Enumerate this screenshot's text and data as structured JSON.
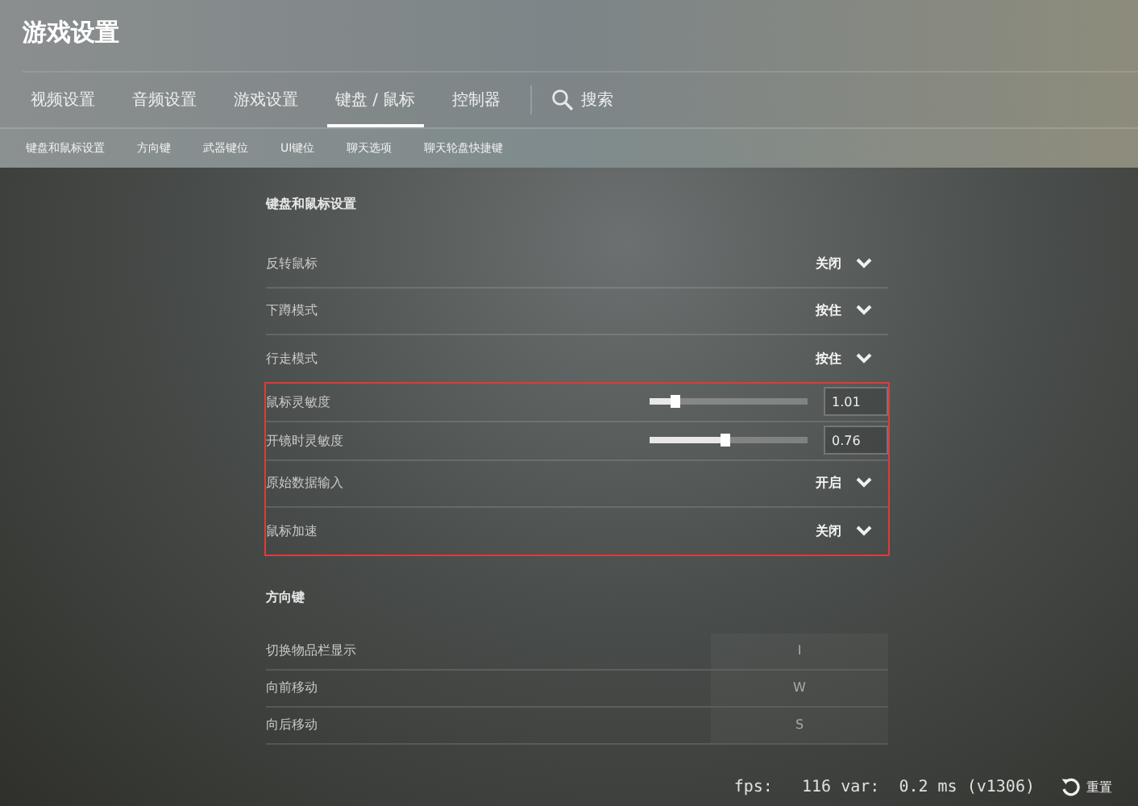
{
  "window": {
    "title": "游戏设置"
  },
  "tabs": [
    {
      "label": "视频设置",
      "selected": false
    },
    {
      "label": "音频设置",
      "selected": false
    },
    {
      "label": "游戏设置",
      "selected": false
    },
    {
      "label": "键盘 / 鼠标",
      "selected": true
    },
    {
      "label": "控制器",
      "selected": false
    }
  ],
  "search": {
    "label": "搜索"
  },
  "subtabs": [
    "键盘和鼠标设置",
    "方向键",
    "武器键位",
    "UI键位",
    "聊天选项",
    "聊天轮盘快捷键"
  ],
  "sections": [
    {
      "title": "键盘和鼠标设置",
      "rows": [
        {
          "kind": "dropdown",
          "label": "反转鼠标",
          "value": "关闭",
          "highlighted": false
        },
        {
          "kind": "dropdown",
          "label": "下蹲模式",
          "value": "按住",
          "highlighted": false
        },
        {
          "kind": "dropdown",
          "label": "行走模式",
          "value": "按住",
          "highlighted": false
        },
        {
          "kind": "slider",
          "label": "鼠标灵敏度",
          "value": "1.01",
          "level": 0.16,
          "highlighted": true
        },
        {
          "kind": "slider",
          "label": "开镜时灵敏度",
          "value": "0.76",
          "level": 0.48,
          "highlighted": true
        },
        {
          "kind": "dropdown",
          "label": "原始数据输入",
          "value": "开启",
          "highlighted": true
        },
        {
          "kind": "dropdown",
          "label": "鼠标加速",
          "value": "关闭",
          "highlighted": true
        }
      ]
    },
    {
      "title": "方向键",
      "rows": [
        {
          "kind": "key",
          "label": "切换物品栏显示",
          "value": "I",
          "highlighted": false
        },
        {
          "kind": "key",
          "label": "向前移动",
          "value": "W",
          "highlighted": false
        },
        {
          "kind": "key",
          "label": "向后移动",
          "value": "S",
          "highlighted": false
        }
      ]
    }
  ],
  "status": "fps:   116 var:  0.2 ms (v1306)",
  "reset_button": {
    "label": "重置"
  }
}
